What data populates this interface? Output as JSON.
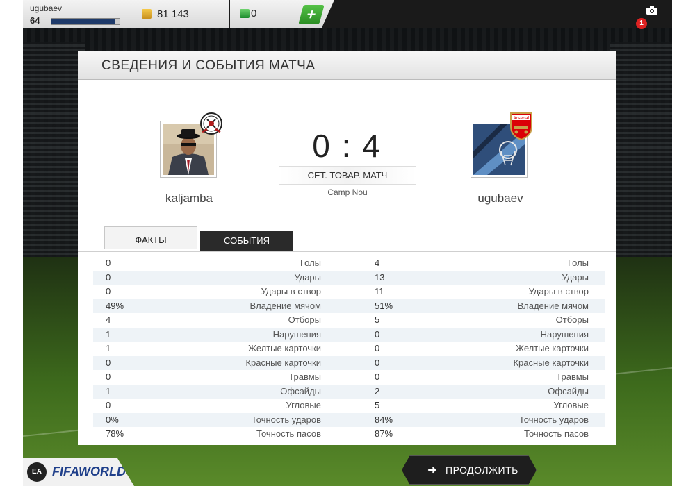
{
  "topbar": {
    "username": "ugubaev",
    "level": "64",
    "xp_fraction": 0.93,
    "coins": "81 143",
    "points": "0",
    "add_label": "+",
    "notification_count": "1"
  },
  "panel": {
    "title": "СВЕДЕНИЯ И СОБЫТИЯ МАТЧА",
    "home_player": "kaljamba",
    "away_player": "ugubaev",
    "score": "0 : 4",
    "match_type": "СЕТ. ТОВАР. МАТЧ",
    "stadium": "Camp Nou",
    "away_badge_text": "Arsenal"
  },
  "tabs": {
    "facts": "ФАКТЫ",
    "events": "СОБЫТИЯ"
  },
  "stats": [
    {
      "label": "Голы",
      "home": "0",
      "away": "4"
    },
    {
      "label": "Удары",
      "home": "0",
      "away": "13"
    },
    {
      "label": "Удары в створ",
      "home": "0",
      "away": "11"
    },
    {
      "label": "Владение мячом",
      "home": "49%",
      "away": "51%"
    },
    {
      "label": "Отборы",
      "home": "4",
      "away": "5"
    },
    {
      "label": "Нарушения",
      "home": "1",
      "away": "0"
    },
    {
      "label": "Желтые карточки",
      "home": "1",
      "away": "0"
    },
    {
      "label": "Красные карточки",
      "home": "0",
      "away": "0"
    },
    {
      "label": "Травмы",
      "home": "0",
      "away": "0"
    },
    {
      "label": "Офсайды",
      "home": "1",
      "away": "2"
    },
    {
      "label": "Угловые",
      "home": "0",
      "away": "5"
    },
    {
      "label": "Точность ударов",
      "home": "0%",
      "away": "84%"
    },
    {
      "label": "Точность пасов",
      "home": "78%",
      "away": "87%"
    }
  ],
  "footer": {
    "logo_badge": "EA",
    "logo_text": "FIFAWORLD",
    "continue_label": "ПРОДОЛЖИТЬ",
    "continue_icon": "arrow-right-icon"
  },
  "colors": {
    "accent_green": "#3aa832",
    "notification_red": "#dd2222",
    "xp_blue": "#1e3a6a"
  }
}
